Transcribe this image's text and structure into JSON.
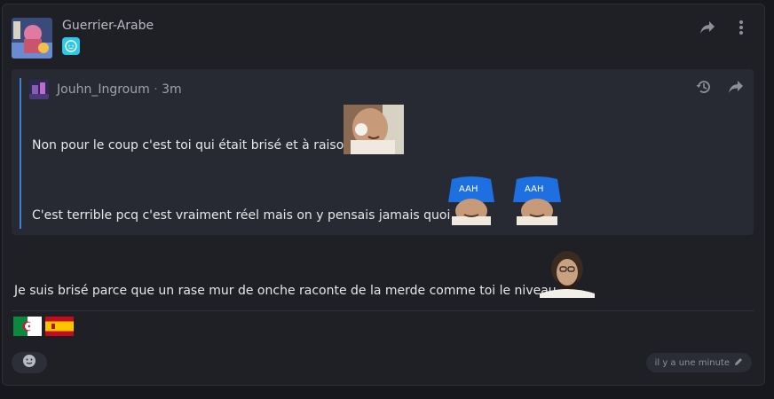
{
  "post": {
    "author": "Guerrier-Arabe",
    "body_text": "Je suis brisé parce que un rase mur de onche raconte de la merde comme toi le niveau",
    "timestamp": "il y a une minute"
  },
  "quote": {
    "author": "Jouhn_Ingroum",
    "separator": "·",
    "time": "3m",
    "line1": "Non pour le coup c'est toi qui était brisé et à raison",
    "line2": "C'est terrible pcq c'est vraiment réel mais on y pensais jamais quoi",
    "sticker_caption": "AAH"
  },
  "icons": {
    "share": "share-icon",
    "more": "more-vert-icon",
    "history": "history-icon",
    "react": "emoji-icon",
    "edit": "pencil-icon"
  },
  "flags": [
    "algeria-flag",
    "spain-flag"
  ],
  "colors": {
    "background": "#16181d",
    "card": "#1e2026",
    "quote_bg": "#272a32",
    "quote_bar": "#3f7fd6",
    "badge": "#2ec7e6"
  }
}
